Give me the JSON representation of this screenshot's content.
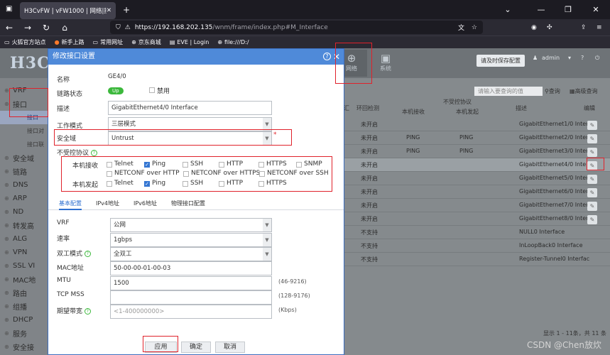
{
  "browser": {
    "tab_title": "H3CvFW | vFW1000 | 网络|接口|新",
    "url_host": "https://192.168.202.135",
    "url_path": "/wnm/frame/index.php#M_Interface",
    "bookmarks": [
      "火狐官方站点",
      "新手上路",
      "常用网址",
      "京东商城",
      "EVE | Login",
      "file:///D:/"
    ]
  },
  "header": {
    "logo": "H3C",
    "nav": [
      {
        "label": "网络",
        "icon": "globe-icon"
      },
      {
        "label": "系统",
        "icon": "monitor-icon"
      }
    ],
    "save_btn": "请及时保存配置",
    "user": "admin"
  },
  "sidebar": {
    "items": [
      {
        "label": "VRF",
        "sub": false
      },
      {
        "label": "接口",
        "sub": false
      },
      {
        "label": "接口",
        "sub": true,
        "active": true
      },
      {
        "label": "接口对",
        "sub": true
      },
      {
        "label": "接口联",
        "sub": true
      },
      {
        "label": "安全域",
        "sub": false
      },
      {
        "label": "链路",
        "sub": false
      },
      {
        "label": "DNS",
        "sub": false
      },
      {
        "label": "ARP",
        "sub": false
      },
      {
        "label": "ND",
        "sub": false
      },
      {
        "label": "转发高",
        "sub": false
      },
      {
        "label": "ALG",
        "sub": false
      },
      {
        "label": "VPN",
        "sub": false
      },
      {
        "label": "SSL VI",
        "sub": false
      },
      {
        "label": "MAC地",
        "sub": false
      },
      {
        "label": "路由",
        "sub": false
      },
      {
        "label": "组播",
        "sub": false
      },
      {
        "label": "DHCP",
        "sub": false
      },
      {
        "label": "服务",
        "sub": false
      },
      {
        "label": "安全接",
        "sub": false
      }
    ]
  },
  "table": {
    "search_placeholder": "请输入要查询的值",
    "query": "查询",
    "adv_search": "高级查询",
    "col_prefix": "汇",
    "col_loopback": "环回检测",
    "col_unprotected": "不受控协议",
    "col_recv": "本机接收",
    "col_send": "本机发起",
    "col_desc": "描述",
    "col_edit": "编辑",
    "rows": [
      {
        "loop": "未开启",
        "recv": "",
        "send": "",
        "desc": "GigabitEthernet1/0 Interf"
      },
      {
        "loop": "未开启",
        "recv": "PING",
        "send": "PING",
        "desc": "GigabitEthernet2/0 Interf"
      },
      {
        "loop": "未开启",
        "recv": "PING",
        "send": "PING",
        "desc": "GigabitEthernet3/0 Interf"
      },
      {
        "loop": "未开启",
        "recv": "",
        "send": "",
        "desc": "GigabitEthernet4/0 Interf"
      },
      {
        "loop": "未开启",
        "recv": "",
        "send": "",
        "desc": "GigabitEthernet5/0 Interf"
      },
      {
        "loop": "未开启",
        "recv": "",
        "send": "",
        "desc": "GigabitEthernet6/0 Interf"
      },
      {
        "loop": "未开启",
        "recv": "",
        "send": "",
        "desc": "GigabitEthernet7/0 Interf"
      },
      {
        "loop": "未开启",
        "recv": "",
        "send": "",
        "desc": "GigabitEthernet8/0 Interf"
      },
      {
        "loop": "不支持",
        "recv": "",
        "send": "",
        "desc": "NULL0 Interface"
      },
      {
        "loop": "不支持",
        "recv": "",
        "send": "",
        "desc": "InLoopBack0 Interface"
      },
      {
        "loop": "不支持",
        "recv": "",
        "send": "",
        "desc": "Register-Tunnel0 Interfac"
      }
    ],
    "footer": "显示 1 - 11条，共 11 条"
  },
  "dialog": {
    "title": "修改接口设置",
    "name_label": "名称",
    "name_value": "GE4/0",
    "link_label": "链路状态",
    "link_status": "Up",
    "disable_label": "禁用",
    "desc_label": "描述",
    "desc_value": "GigabitEthernet4/0 Interface",
    "mode_label": "工作模式",
    "mode_value": "三层模式",
    "zone_label": "安全域",
    "zone_value": "Untrust",
    "unprot_label": "不受控协议",
    "recv_label": "本机接收",
    "send_label": "本机发起",
    "recv_protos": [
      {
        "name": "Telnet",
        "on": false
      },
      {
        "name": "Ping",
        "on": true
      },
      {
        "name": "SSH",
        "on": false
      },
      {
        "name": "HTTP",
        "on": false
      },
      {
        "name": "HTTPS",
        "on": false
      },
      {
        "name": "SNMP",
        "on": false
      },
      {
        "name": "NETCONF over HTTP",
        "on": false
      },
      {
        "name": "NETCONF over HTTPS",
        "on": false
      },
      {
        "name": "NETCONF over SSH",
        "on": false
      }
    ],
    "send_protos": [
      {
        "name": "Telnet",
        "on": false
      },
      {
        "name": "Ping",
        "on": true
      },
      {
        "name": "SSH",
        "on": false
      },
      {
        "name": "HTTP",
        "on": false
      },
      {
        "name": "HTTPS",
        "on": false
      }
    ],
    "tabs": [
      "基本配置",
      "IPv4地址",
      "IPv6地址",
      "物理接口配置"
    ],
    "vrf_label": "VRF",
    "vrf_value": "公网",
    "speed_label": "速率",
    "speed_value": "1gbps",
    "duplex_label": "双工模式",
    "duplex_value": "全双工",
    "mac_label": "MAC地址",
    "mac_value": "50-00-00-01-00-03",
    "mtu_label": "MTU",
    "mtu_value": "1500",
    "mtu_hint": "(46-9216)",
    "tcpmss_label": "TCP MSS",
    "tcpmss_value": "",
    "tcpmss_hint": "(128-9176)",
    "bw_label": "期望带宽",
    "bw_placeholder": "<1-400000000>",
    "bw_hint": "(Kbps)",
    "apply": "应用",
    "ok": "确定",
    "cancel": "取消"
  },
  "watermark": "CSDN @Chen放炊"
}
